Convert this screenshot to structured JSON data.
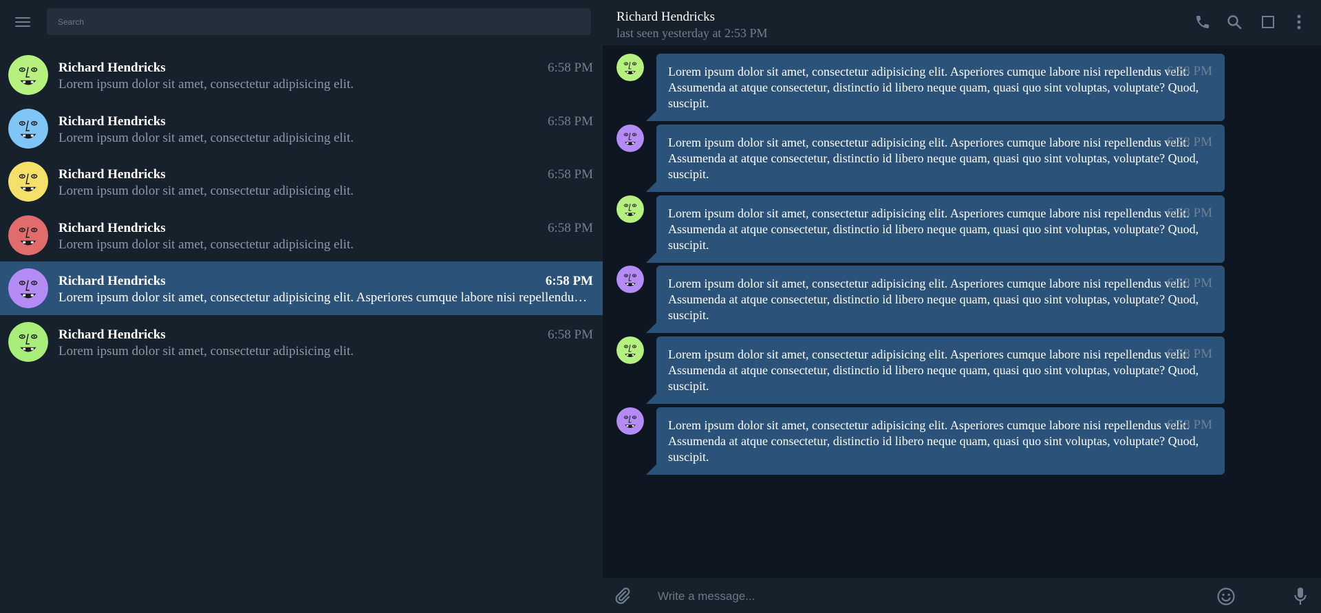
{
  "sidebar": {
    "search": {
      "placeholder": "Search"
    },
    "chats": [
      {
        "name": "Richard Hendricks",
        "time": "6:58 PM",
        "preview": "Lorem ipsum dolor sit amet, consectetur adipisicing elit.",
        "avatar_color": "#b6f07f"
      },
      {
        "name": "Richard Hendricks",
        "time": "6:58 PM",
        "preview": "Lorem ipsum dolor sit amet, consectetur adipisicing elit.",
        "avatar_color": "#7fc6f7"
      },
      {
        "name": "Richard Hendricks",
        "time": "6:58 PM",
        "preview": "Lorem ipsum dolor sit amet, consectetur adipisicing elit.",
        "avatar_color": "#f5e06a"
      },
      {
        "name": "Richard Hendricks",
        "time": "6:58 PM",
        "preview": "Lorem ipsum dolor sit amet, consectetur adipisicing elit.",
        "avatar_color": "#e06c6c"
      },
      {
        "name": "Richard Hendricks",
        "time": "6:58 PM",
        "preview": "Lorem ipsum dolor sit amet, consectetur adipisicing elit. Asperiores cumque labore nisi repellendus velit.",
        "avatar_color": "#b58cf5",
        "active": true
      },
      {
        "name": "Richard Hendricks",
        "time": "6:58 PM",
        "preview": "Lorem ipsum dolor sit amet, consectetur adipisicing elit.",
        "avatar_color": "#a8ec7a"
      }
    ]
  },
  "conversation": {
    "name": "Richard Hendricks",
    "status": "last seen yesterday at 2:53 PM",
    "header_icons": [
      "phone-icon",
      "search-icon",
      "square-icon",
      "more-vertical-icon"
    ],
    "messages": [
      {
        "text": "Lorem ipsum dolor sit amet, consectetur adipisicing elit. Asperiores cumque labore nisi repellendus velit. Assumenda at atque consectetur, distinctio id libero neque quam, quasi quo sint voluptas, voluptate? Quod, suscipit.",
        "time": "6:58 PM",
        "avatar_color": "#b6f07f"
      },
      {
        "text": "Lorem ipsum dolor sit amet, consectetur adipisicing elit. Asperiores cumque labore nisi repellendus velit. Assumenda at atque consectetur, distinctio id libero neque quam, quasi quo sint voluptas, voluptate? Quod, suscipit.",
        "time": "6:58 PM",
        "avatar_color": "#b58cf5"
      },
      {
        "text": "Lorem ipsum dolor sit amet, consectetur adipisicing elit. Asperiores cumque labore nisi repellendus velit. Assumenda at atque consectetur, distinctio id libero neque quam, quasi quo sint voluptas, voluptate? Quod, suscipit.",
        "time": "6:58 PM",
        "avatar_color": "#b6f07f"
      },
      {
        "text": "Lorem ipsum dolor sit amet, consectetur adipisicing elit. Asperiores cumque labore nisi repellendus velit. Assumenda at atque consectetur, distinctio id libero neque quam, quasi quo sint voluptas, voluptate? Quod, suscipit.",
        "time": "6:58 PM",
        "avatar_color": "#b58cf5"
      },
      {
        "text": "Lorem ipsum dolor sit amet, consectetur adipisicing elit. Asperiores cumque labore nisi repellendus velit. Assumenda at atque consectetur, distinctio id libero neque quam, quasi quo sint voluptas, voluptate? Quod, suscipit.",
        "time": "6:58 PM",
        "avatar_color": "#b6f07f"
      },
      {
        "text": "Lorem ipsum dolor sit amet, consectetur adipisicing elit. Asperiores cumque labore nisi repellendus velit. Assumenda at atque consectetur, distinctio id libero neque quam, quasi quo sint voluptas, voluptate? Quod, suscipit.",
        "time": "6:58 PM",
        "avatar_color": "#b58cf5"
      }
    ],
    "composer": {
      "placeholder": "Write a message..."
    }
  }
}
